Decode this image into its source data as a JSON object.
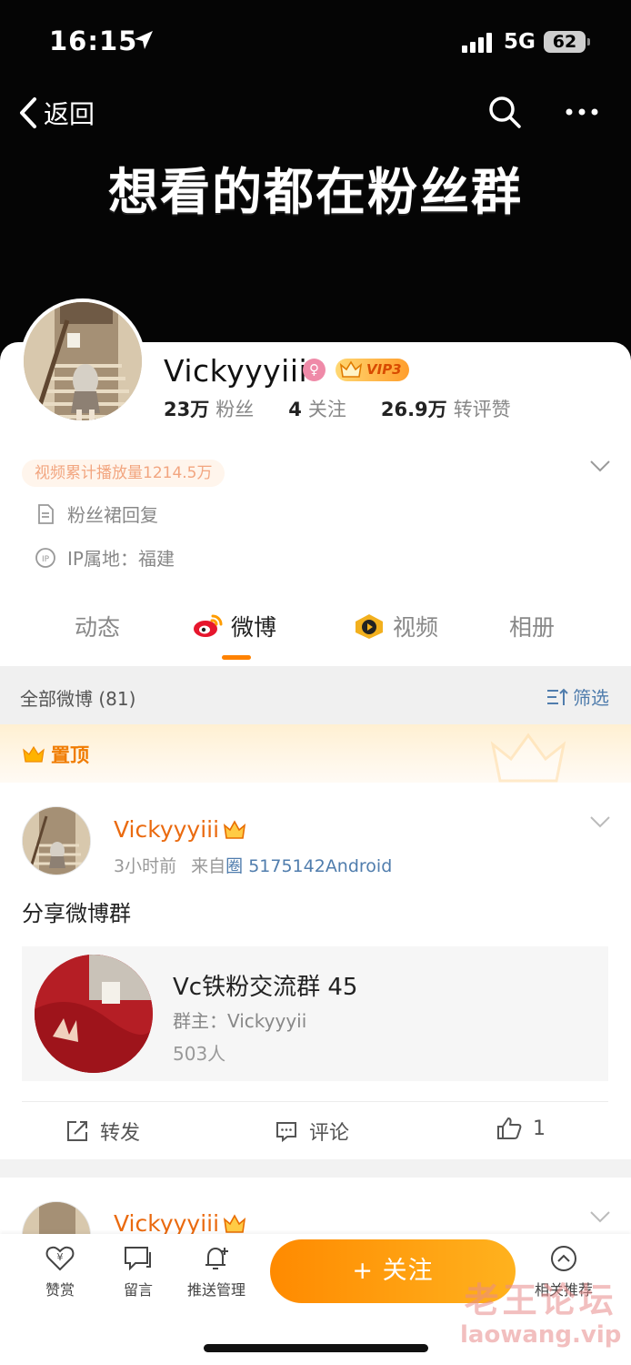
{
  "status_bar": {
    "time": "16:15",
    "network": "5G",
    "battery": "62"
  },
  "nav": {
    "back_label": "返回"
  },
  "cover": {
    "text": "想看的都在粉丝群"
  },
  "profile": {
    "name": "Vickyyyiii",
    "vip_label": "VIP3",
    "stats": [
      {
        "value": "23万",
        "label": "粉丝"
      },
      {
        "value": "4",
        "label": "关注"
      },
      {
        "value": "26.9万",
        "label": "转评赞"
      }
    ],
    "play_count": "视频累计播放量1214.5万",
    "description": "粉丝裙回复",
    "ip_location": "IP属地：福建"
  },
  "tabs": [
    {
      "label": "动态",
      "active": false
    },
    {
      "label": "微博",
      "active": true
    },
    {
      "label": "视频",
      "active": false
    },
    {
      "label": "相册",
      "active": false
    }
  ],
  "filter_bar": {
    "all_label": "全部微博 (81)",
    "filter_label": "筛选"
  },
  "pinned": {
    "label": "置顶"
  },
  "post": {
    "author": "Vickyyyiii",
    "time": "3小时前",
    "source_prefix": "来自",
    "source": "圈 5175142Android",
    "text": "分享微博群",
    "group": {
      "title": "Vc铁粉交流群 45",
      "owner": "群主：Vickyyyii",
      "members": "503人"
    },
    "actions": {
      "repost": "转发",
      "comment": "评论",
      "like_count": "1"
    }
  },
  "post2": {
    "author": "Vickyyyiii"
  },
  "bottom_bar": {
    "reward": "赞赏",
    "message": "留言",
    "push": "推送管理",
    "follow": "+ 关注",
    "related": "相关推荐"
  },
  "watermark": {
    "cn": "老王论坛",
    "en": "laowang.vip"
  },
  "colors": {
    "accent": "#ff8200",
    "link": "#507dad",
    "author": "#ea6a0f"
  }
}
